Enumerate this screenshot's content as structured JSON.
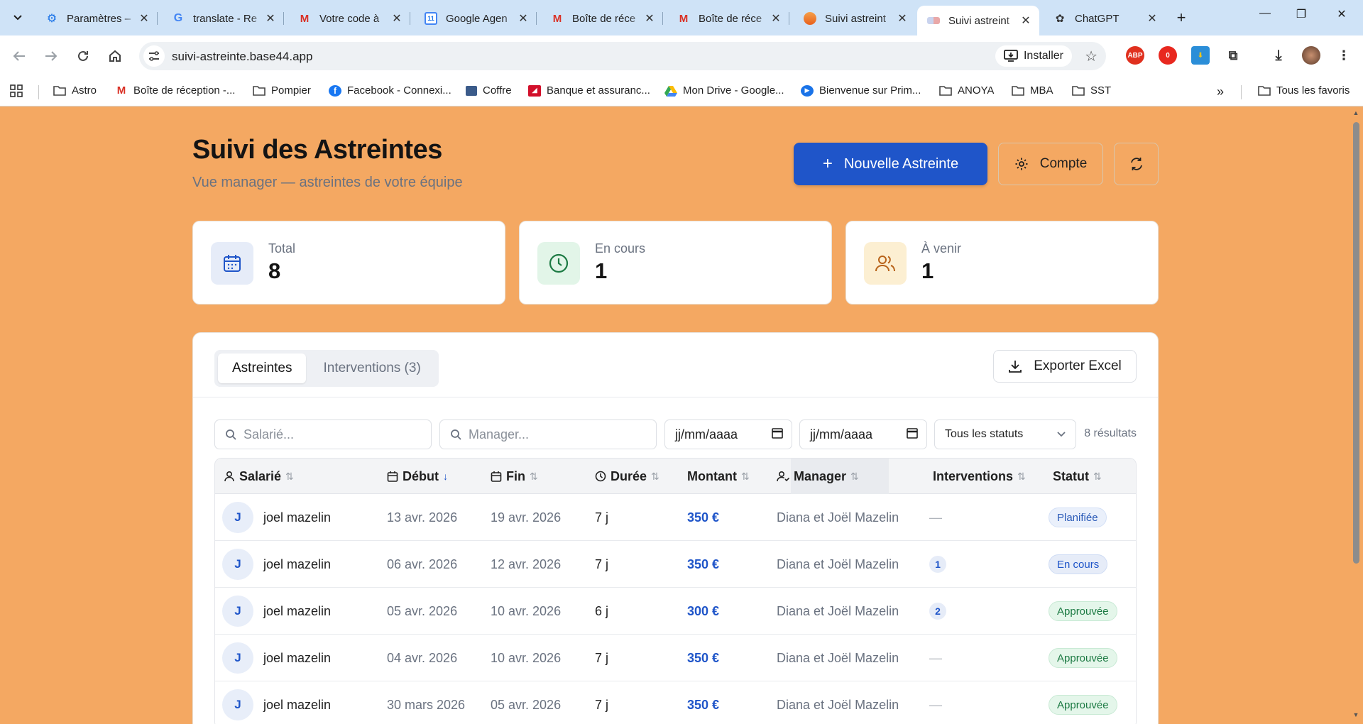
{
  "browser": {
    "tabs": [
      {
        "title": "Paramètres – ",
        "icon": "gear-icon"
      },
      {
        "title": "translate - Re",
        "icon": "google-icon"
      },
      {
        "title": "Votre code à",
        "icon": "gmail-icon"
      },
      {
        "title": "Google Agen",
        "icon": "calendar-icon"
      },
      {
        "title": "Boîte de réce",
        "icon": "gmail-icon"
      },
      {
        "title": "Boîte de réce",
        "icon": "gmail-icon"
      },
      {
        "title": "Suivi astreint",
        "icon": "app-icon"
      },
      {
        "title": "Suivi astreint",
        "icon": "app-icon"
      },
      {
        "title": "ChatGPT",
        "icon": "chatgpt-icon"
      }
    ],
    "url": "suivi-astreinte.base44.app",
    "install_label": "Installer",
    "bookmarks": [
      {
        "label": "Astro",
        "icon": "folder-icon"
      },
      {
        "label": "Boîte de réception -...",
        "icon": "gmail-icon"
      },
      {
        "label": "Pompier",
        "icon": "folder-icon"
      },
      {
        "label": "Facebook - Connexi...",
        "icon": "facebook-icon"
      },
      {
        "label": "Coffre",
        "icon": "vault-icon"
      },
      {
        "label": "Banque et assuranc...",
        "icon": "bank-icon"
      },
      {
        "label": "Mon Drive - Google...",
        "icon": "drive-icon"
      },
      {
        "label": "Bienvenue sur Prim...",
        "icon": "prime-icon"
      },
      {
        "label": "ANOYA",
        "icon": "folder-icon"
      },
      {
        "label": "MBA",
        "icon": "folder-icon"
      },
      {
        "label": "SST",
        "icon": "folder-icon"
      }
    ],
    "all_bookmarks_label": "Tous les favoris",
    "colors": {
      "tabstrip": "#cfe3f7",
      "page_bg": "#f4a862",
      "primary": "#1f55c9"
    }
  },
  "header": {
    "title": "Suivi des Astreintes",
    "subtitle": "Vue manager — astreintes de votre équipe",
    "new_button": "Nouvelle Astreinte",
    "account_button": "Compte"
  },
  "stats": [
    {
      "label": "Total",
      "value": "8",
      "icon": "calendar-icon"
    },
    {
      "label": "En cours",
      "value": "1",
      "icon": "clock-icon"
    },
    {
      "label": "À venir",
      "value": "1",
      "icon": "users-icon"
    }
  ],
  "panel": {
    "tabs": [
      "Astreintes",
      "Interventions (3)"
    ],
    "export_button": "Exporter Excel",
    "filters": {
      "employee_placeholder": "Salarié...",
      "manager_placeholder": "Manager...",
      "date_from": "jj/mm/aaaa",
      "date_to": "jj/mm/aaaa",
      "status_select": "Tous les statuts"
    },
    "results": "8 résultats"
  },
  "table": {
    "columns": [
      "Salarié",
      "Début",
      "Fin",
      "Durée",
      "Montant",
      "Manager",
      "Interventions",
      "Statut"
    ],
    "rows": [
      {
        "initial": "J",
        "employee": "joel mazelin",
        "start": "13 avr. 2026",
        "end": "19 avr. 2026",
        "duration": "7 j",
        "amount": "350 €",
        "manager": "Diana et Joël Mazelin",
        "interventions": "—",
        "status": "Planifiée"
      },
      {
        "initial": "J",
        "employee": "joel mazelin",
        "start": "06 avr. 2026",
        "end": "12 avr. 2026",
        "duration": "7 j",
        "amount": "350 €",
        "manager": "Diana et Joël Mazelin",
        "interventions": "1",
        "status": "En cours"
      },
      {
        "initial": "J",
        "employee": "joel mazelin",
        "start": "05 avr. 2026",
        "end": "10 avr. 2026",
        "duration": "6 j",
        "amount": "300 €",
        "manager": "Diana et Joël Mazelin",
        "interventions": "2",
        "status": "Approuvée"
      },
      {
        "initial": "J",
        "employee": "joel mazelin",
        "start": "04 avr. 2026",
        "end": "10 avr. 2026",
        "duration": "7 j",
        "amount": "350 €",
        "manager": "Diana et Joël Mazelin",
        "interventions": "—",
        "status": "Approuvée"
      },
      {
        "initial": "J",
        "employee": "joel mazelin",
        "start": "30 mars 2026",
        "end": "05 avr. 2026",
        "duration": "7 j",
        "amount": "350 €",
        "manager": "Diana et Joël Mazelin",
        "interventions": "—",
        "status": "Approuvée"
      }
    ]
  }
}
